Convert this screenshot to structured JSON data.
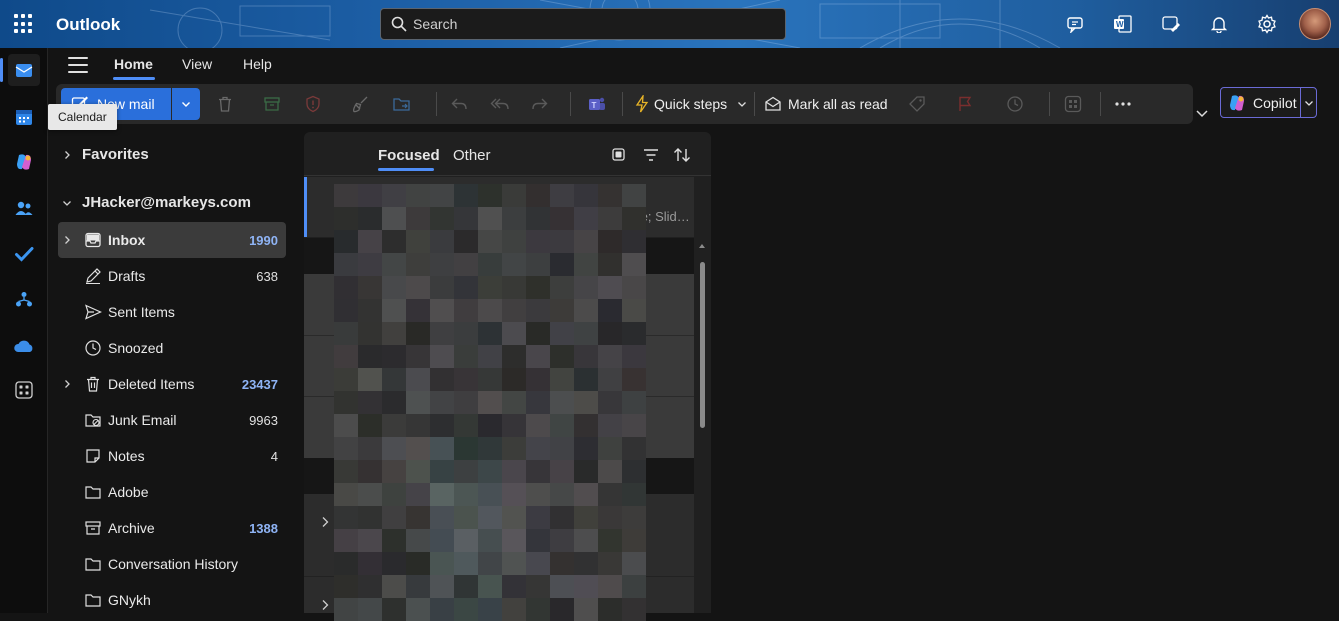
{
  "topbar": {
    "app_title": "Outlook",
    "search_placeholder": "Search",
    "icons": [
      "app-launcher-icon",
      "meet-now-icon",
      "word-icon",
      "whats-new-icon",
      "notifications-bell-icon",
      "settings-gear-icon",
      "avatar"
    ]
  },
  "rail": {
    "items": [
      "mail-icon",
      "calendar-icon",
      "copilot-app-icon",
      "people-icon",
      "todo-check-icon",
      "org-explorer-icon",
      "onedrive-cloud-icon",
      "more-apps-icon"
    ],
    "tooltip": "Calendar"
  },
  "nav_tabs": [
    {
      "label": "Home",
      "active": true
    },
    {
      "label": "View",
      "active": false
    },
    {
      "label": "Help",
      "active": false
    }
  ],
  "ribbon": {
    "new_mail": "New mail",
    "quick_steps": "Quick steps",
    "mark_all_read": "Mark all as read",
    "copilot": "Copilot"
  },
  "folders": {
    "favorites": "Favorites",
    "account": "JHacker@markeys.com",
    "items": [
      {
        "name": "Inbox",
        "count": "1990",
        "unread": true,
        "selected": true,
        "expandable": true,
        "icon": "inbox-icon"
      },
      {
        "name": "Drafts",
        "count": "638",
        "unread": false,
        "selected": false,
        "expandable": false,
        "icon": "drafts-pencil-icon"
      },
      {
        "name": "Sent Items",
        "count": "",
        "unread": false,
        "selected": false,
        "expandable": false,
        "icon": "send-icon"
      },
      {
        "name": "Snoozed",
        "count": "",
        "unread": false,
        "selected": false,
        "expandable": false,
        "icon": "clock-icon"
      },
      {
        "name": "Deleted Items",
        "count": "23437",
        "unread": true,
        "selected": false,
        "expandable": true,
        "icon": "trash-icon"
      },
      {
        "name": "Junk Email",
        "count": "9963",
        "unread": false,
        "selected": false,
        "expandable": false,
        "icon": "junk-folder-icon"
      },
      {
        "name": "Notes",
        "count": "4",
        "unread": false,
        "selected": false,
        "expandable": false,
        "icon": "note-icon"
      },
      {
        "name": "Adobe",
        "count": "",
        "unread": false,
        "selected": false,
        "expandable": false,
        "icon": "folder-icon"
      },
      {
        "name": "Archive",
        "count": "1388",
        "unread": true,
        "selected": false,
        "expandable": false,
        "icon": "archive-icon"
      },
      {
        "name": "Conversation History",
        "count": "",
        "unread": false,
        "selected": false,
        "expandable": false,
        "icon": "folder-icon"
      },
      {
        "name": "GNykh",
        "count": "",
        "unread": false,
        "selected": false,
        "expandable": false,
        "icon": "folder-icon"
      }
    ]
  },
  "message_list": {
    "tabs": [
      {
        "label": "Focused",
        "active": true
      },
      {
        "label": "Other",
        "active": false
      }
    ],
    "first_preview": "te; Slid…"
  },
  "colors": {
    "accent": "#4f8ef7",
    "new_mail_button": "#2a6fdb",
    "unread_count": "#8fb4f5",
    "background": "#141414"
  }
}
